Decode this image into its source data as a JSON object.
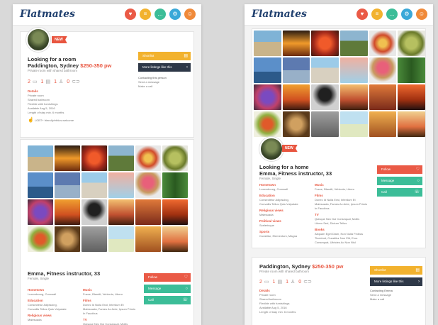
{
  "app": {
    "logo": "Flatmates"
  },
  "nav_icons": [
    {
      "name": "heart-icon",
      "glyph": "♥",
      "color": "#ea5a46"
    },
    {
      "name": "document-icon",
      "glyph": "≡",
      "color": "#f2b22e"
    },
    {
      "name": "chat-icon",
      "glyph": "…",
      "color": "#3cbd98"
    },
    {
      "name": "settings-icon",
      "glyph": "⚙",
      "color": "#3aa8d8"
    },
    {
      "name": "avatar-icon",
      "glyph": "☺",
      "color": "#f08a3a"
    }
  ],
  "room_listing": {
    "badge": "NEW",
    "title": "Looking for a room",
    "location": "Paddington, Sydney",
    "price": "$250-350 pw",
    "subtitle": "Private room with shared bathroom",
    "stats": {
      "bed": "2",
      "bath": "1",
      "people": "1",
      "car": "0"
    },
    "details_heading": "Details",
    "details": [
      "Private room",
      "Shared bathroom",
      "Flexible with furnishings",
      "Available Aug 5, 2016",
      "Length of stay min. 6 months"
    ],
    "lgbt_note": "LGBT+ friendly/ethics welcome",
    "shortlist_label": "Shortlist",
    "more_label": "More listings like this",
    "contact_heading": "Contacting this person",
    "contact_options": [
      "Send a message",
      "Make a call"
    ]
  },
  "profile_small": {
    "name": "Emma, Fitness instructor, 33",
    "sub": "Female, Single",
    "left_sections": [
      {
        "heading": "Hometown",
        "text": [
          "Luxembourg, Cornwall"
        ]
      },
      {
        "heading": "Education",
        "text": [
          "Consectetur Adipiscing,",
          "Convallis Tellus Quis Vulputate"
        ]
      },
      {
        "heading": "Religious views",
        "text": [
          "Malesuada"
        ]
      }
    ],
    "right_sections": [
      {
        "heading": "Music",
        "text": [
          "Fusce, Blandit, Vehicula, Libero"
        ]
      },
      {
        "heading": "Films",
        "text": [
          "Donec Id Nulla Erat, Interdum Et",
          "Malesuada, Fames Ac Ante, Ipsum Primis",
          "In Faucibus"
        ]
      },
      {
        "heading": "TV",
        "text": [
          "Quisque Nec Dui Consequat, Mollis"
        ]
      }
    ],
    "follow_label": "Follow",
    "message_label": "Message",
    "call_label": "Call"
  },
  "profile_large": {
    "badge": "NEW",
    "title": "Looking for a home",
    "name": "Emma, Fitness instructor, 33",
    "sub": "Female, Single",
    "left_sections": [
      {
        "heading": "Hometown",
        "text": [
          "Luxembourg, Cornwall"
        ]
      },
      {
        "heading": "Education",
        "text": [
          "Consectetur Adipiscing,",
          "Convallis Tellus Quis Vulputate"
        ]
      },
      {
        "heading": "Religious views",
        "text": [
          "Malesuada"
        ]
      },
      {
        "heading": "Political views",
        "text": [
          "Scelerisque"
        ]
      },
      {
        "heading": "Sports",
        "text": [
          "Curabitur, Elementum, Magna"
        ]
      }
    ],
    "right_sections": [
      {
        "heading": "Music",
        "text": [
          "Fusce, Blandit, Vehicula, Libero"
        ]
      },
      {
        "heading": "Films",
        "text": [
          "Donec Id Nulla Erat, Interdum Et",
          "Malesuada, Fames Ac Ante, Ipsum Primis",
          "In Faucibus"
        ]
      },
      {
        "heading": "TV",
        "text": [
          "Quisque Nec Dui Consequat, Mollis",
          "Libero Sed, Dictum Tellus"
        ]
      },
      {
        "heading": "Books",
        "text": [
          "Aliquam Eget Diam, Non Nulla Finibus",
          "Tincidunt, Curabitur Non Elit, Eros",
          "Consequat, Ultricies Ac Non Nisl"
        ]
      }
    ],
    "follow_label": "Follow",
    "message_label": "Message",
    "call_label": "Call"
  },
  "room_listing_2": {
    "location": "Paddington, Sydney",
    "price": "$250-350 pw",
    "subtitle": "Private room with shared bathroom",
    "stats": {
      "bed": "2",
      "bath": "1",
      "people": "1",
      "car": "0"
    },
    "details_heading": "Details",
    "details": [
      "Private room",
      "Shared bathroom",
      "Flexible with furnishings",
      "Available Aug 5, 2016",
      "Length of stay min. 6 months"
    ],
    "shortlist_label": "Shortlist",
    "more_label": "More listings like this",
    "contact_heading": "Contacting Emma",
    "contact_options": [
      "Send a message",
      "Make a call"
    ]
  }
}
